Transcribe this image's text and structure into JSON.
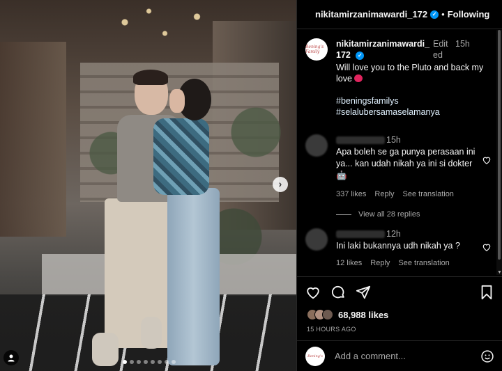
{
  "post": {
    "carousel_dots": 8,
    "carousel_active": 1
  },
  "header": {
    "username": "nikitamirzanimawardi_172",
    "separator": "•",
    "follow_label": "Following"
  },
  "caption": {
    "avatar_text": "Bening's Family",
    "username": "nikitamirzanimawardi_172",
    "edited": "Edited",
    "time": "15h",
    "text": "Will love you to the Pluto and back my love",
    "hashtag1": "#beningsfamilys",
    "hashtag2": "#selalubersamaselamanya"
  },
  "comments": [
    {
      "time": "15h",
      "text": "Apa boleh se ga punya perasaan ini ya... kan udah nikah ya ini si dokter 🤖",
      "likes": "337 likes",
      "reply": "Reply",
      "translate": "See translation",
      "view_replies": "View all 28 replies"
    },
    {
      "time": "12h",
      "text": "Ini laki bukannya udh nikah ya ?",
      "likes": "12 likes",
      "reply": "Reply",
      "translate": "See translation"
    }
  ],
  "stats": {
    "likes": "68,988 likes",
    "time_ago": "15 HOURS AGO"
  },
  "comment_box": {
    "placeholder": "Add a comment...",
    "avatar_text": "Bening's"
  },
  "colors": {
    "verified": "#0095f6",
    "background": "#000000",
    "muted": "#a8a8a8"
  }
}
